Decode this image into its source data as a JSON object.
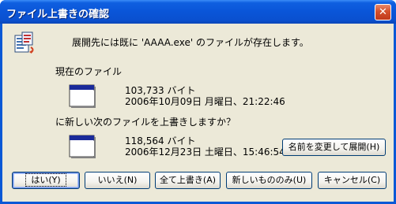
{
  "window": {
    "title": "ファイル上書きの確認",
    "close_label": "✕"
  },
  "message": "展開先には既に 'AAAA.exe' のファイルが存在します。",
  "current": {
    "label": "現在のファイル",
    "size": "103,733 バイト",
    "date": "2006年10月09日  月曜日、21:22:46"
  },
  "question": "に新しい次のファイルを上書きしますか？",
  "new_file": {
    "size": "118,564 バイト",
    "date": "2006年12月23日  土曜日、15:46:54"
  },
  "buttons": {
    "rename": "名前を変更して展開(H)",
    "yes": "はい(Y)",
    "no": "いいえ(N)",
    "overwrite_all": "全て上書き(A)",
    "newer_only": "新しいもののみ(U)",
    "cancel": "キャンセル(C)"
  },
  "colors": {
    "titlebar": "#0a55d8",
    "client": "#ece9d8",
    "accent_border": "#003c74"
  },
  "icons": {
    "message": "file-overwrite-icon",
    "file": "application-window-icon"
  }
}
